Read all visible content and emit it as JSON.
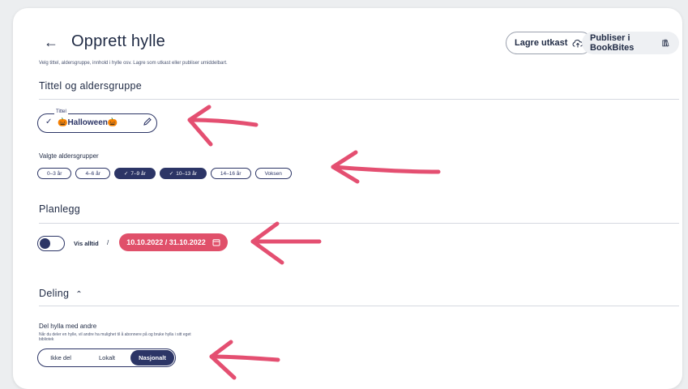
{
  "header": {
    "back_icon": "arrow-left-icon",
    "title": "Opprett hylle",
    "draft_label": "Lagre utkast",
    "publish_label": "Publiser i BookBites",
    "subtitle": "Velg tittel, aldersgruppe, innhold i hylle osv. Lagre som utkast eller publiser umiddelbart."
  },
  "title_section": {
    "heading": "Tittel og aldersgruppe",
    "field_legend": "Tittel",
    "field_value": "🎃Halloween🎃",
    "age_label": "Valgte aldersgrupper",
    "age_groups": [
      {
        "label": "0–3 år",
        "selected": false
      },
      {
        "label": "4–6 år",
        "selected": false
      },
      {
        "label": "7–9 år",
        "selected": true
      },
      {
        "label": "10–13 år",
        "selected": true
      },
      {
        "label": "14–16 år",
        "selected": false
      },
      {
        "label": "Voksen",
        "selected": false
      }
    ]
  },
  "plan_section": {
    "heading": "Planlegg",
    "show_always_label": "Vis alltid",
    "separator": "/",
    "date_range": "10.10.2022 / 31.10.2022"
  },
  "sharing_section": {
    "heading": "Deling",
    "share_title": "Del hylla med andre",
    "share_desc": "Når du deler en hylle, vil andre ha mulighet til å abonnere på og bruke hylla i sitt eget bibliotek",
    "options": [
      "Ikke del",
      "Lokalt",
      "Nasjonalt"
    ],
    "selected": "Nasjonalt"
  },
  "colors": {
    "primary": "#2c3566",
    "accent": "#e0506a",
    "arrow": "#e44f71"
  }
}
